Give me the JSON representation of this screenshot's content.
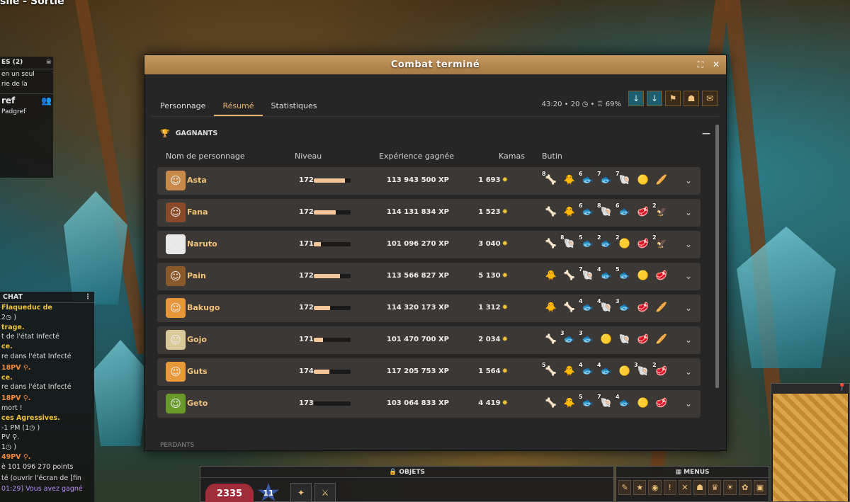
{
  "zone": {
    "title": "sile - Sortie"
  },
  "quests": {
    "header": "ES (2)",
    "lines": [
      "en un seul",
      "rie de la"
    ],
    "section": "ref",
    "section_line": "Padgref"
  },
  "chat": {
    "header": "CHAT",
    "lines": [
      {
        "text": "Flaqueduc de",
        "cls": "yellow-first"
      },
      {
        "text": "2◷ )",
        "cls": ""
      },
      {
        "text": "trage.",
        "cls": "yellow-all"
      },
      {
        "text": "t de l'état Infecté",
        "cls": ""
      },
      {
        "text": "ce.",
        "cls": "yellow-all"
      },
      {
        "text": "re dans l'état Infecté",
        "cls": ""
      },
      {
        "text": "",
        "cls": ""
      },
      {
        "text": "18PV ⚲.",
        "cls": "orange-first"
      },
      {
        "text": "ce.",
        "cls": "yellow-all"
      },
      {
        "text": "re dans l'état Infecté",
        "cls": ""
      },
      {
        "text": "",
        "cls": ""
      },
      {
        "text": "18PV ⚲.",
        "cls": "orange-first"
      },
      {
        "text": "mort !",
        "cls": ""
      },
      {
        "text": "ces Agressives.",
        "cls": "yellow-all"
      },
      {
        "text": "-1 PM (1◷ )",
        "cls": ""
      },
      {
        "text": "PV ⚲.",
        "cls": ""
      },
      {
        "text": "1◷ )",
        "cls": ""
      },
      {
        "text": "49PV ⚲.",
        "cls": "orange-first"
      },
      {
        "text": "è 101 096 270 points",
        "cls": ""
      },
      {
        "text": "",
        "cls": ""
      },
      {
        "text": "té (ouvrir l'écran de [fin",
        "cls": ""
      },
      {
        "text": "",
        "cls": ""
      },
      {
        "text": "01:29] Vous avez gagné",
        "cls": "purple"
      }
    ]
  },
  "window": {
    "title": "Combat terminé",
    "tabs": [
      "Personnage",
      "Résumé",
      "Statistiques"
    ],
    "active_tab": 1,
    "fight_info": "43:20 • 20 ◷ • ♖ 69%",
    "section_title": "GAGNANTS",
    "losers_title": "PERDANTS",
    "columns": {
      "name": "Nom de personnage",
      "level": "Niveau",
      "xp": "Expérience gagnée",
      "kamas": "Kamas",
      "loot": "Butin"
    },
    "winners": [
      {
        "name": "Asta",
        "level": "172",
        "level_fill": 0.85,
        "xp": "113 943 500 XP",
        "kamas": "1 693",
        "avatar_color": "#c9894a",
        "avatar": "☺",
        "loot": [
          {
            "q": "8",
            "i": "🦴"
          },
          {
            "q": "",
            "i": "🐥"
          },
          {
            "q": "6",
            "i": "🐟"
          },
          {
            "q": "7",
            "i": "🐟"
          },
          {
            "q": "7",
            "i": "🐚"
          },
          {
            "q": "",
            "i": "🟡"
          },
          {
            "q": "",
            "i": "🥖"
          }
        ]
      },
      {
        "name": "Fana",
        "level": "172",
        "level_fill": 0.6,
        "xp": "114 131 834 XP",
        "kamas": "1 523",
        "avatar_color": "#8a4a2a",
        "avatar": "☺",
        "loot": [
          {
            "q": "",
            "i": "🦴"
          },
          {
            "q": "",
            "i": "🐥"
          },
          {
            "q": "6",
            "i": "🐟"
          },
          {
            "q": "8",
            "i": "🐚"
          },
          {
            "q": "6",
            "i": "🐟"
          },
          {
            "q": "",
            "i": "🥩"
          },
          {
            "q": "2",
            "i": "🦅"
          }
        ]
      },
      {
        "name": "Naruto",
        "level": "171",
        "level_fill": 0.2,
        "xp": "101 096 270 XP",
        "kamas": "3 040",
        "avatar_color": "#e8e8e8",
        "avatar": "☺",
        "loot": [
          {
            "q": "",
            "i": "🦴"
          },
          {
            "q": "8",
            "i": "🐚"
          },
          {
            "q": "5",
            "i": "🐟"
          },
          {
            "q": "2",
            "i": "🐟"
          },
          {
            "q": "2",
            "i": "🟡"
          },
          {
            "q": "",
            "i": "🥩"
          },
          {
            "q": "2",
            "i": "🦅"
          }
        ]
      },
      {
        "name": "Pain",
        "level": "172",
        "level_fill": 0.72,
        "xp": "113 566 827 XP",
        "kamas": "5 130",
        "avatar_color": "#8a5a2a",
        "avatar": "☺",
        "loot": [
          {
            "q": "",
            "i": "🐥"
          },
          {
            "q": "",
            "i": "🦴"
          },
          {
            "q": "7",
            "i": "🐚"
          },
          {
            "q": "4",
            "i": "🐟"
          },
          {
            "q": "5",
            "i": "🐟"
          },
          {
            "q": "",
            "i": "🟡"
          },
          {
            "q": "",
            "i": "🥩"
          }
        ]
      },
      {
        "name": "Bakugo",
        "level": "172",
        "level_fill": 0.45,
        "xp": "114 320 173 XP",
        "kamas": "1 312",
        "avatar_color": "#e8963a",
        "avatar": "☺",
        "loot": [
          {
            "q": "",
            "i": "🐥"
          },
          {
            "q": "",
            "i": "🦴"
          },
          {
            "q": "4",
            "i": "🐟"
          },
          {
            "q": "4",
            "i": "🐚"
          },
          {
            "q": "3",
            "i": "🐟"
          },
          {
            "q": "",
            "i": "🥩"
          },
          {
            "q": "",
            "i": "🥖"
          }
        ]
      },
      {
        "name": "Gojo",
        "level": "171",
        "level_fill": 0.25,
        "xp": "101 470 700 XP",
        "kamas": "2 034",
        "avatar_color": "#d8c89a",
        "avatar": "☺",
        "loot": [
          {
            "q": "",
            "i": "🦴"
          },
          {
            "q": "3",
            "i": "🐟"
          },
          {
            "q": "3",
            "i": "🐟"
          },
          {
            "q": "",
            "i": "🟡"
          },
          {
            "q": "",
            "i": "🐚"
          },
          {
            "q": "",
            "i": "🥩"
          },
          {
            "q": "",
            "i": "🥖"
          }
        ]
      },
      {
        "name": "Guts",
        "level": "174",
        "level_fill": 0.42,
        "xp": "117 205 753 XP",
        "kamas": "1 564",
        "avatar_color": "#e89a3a",
        "avatar": "☺",
        "loot": [
          {
            "q": "5",
            "i": "🦴"
          },
          {
            "q": "",
            "i": "🐥"
          },
          {
            "q": "4",
            "i": "🐟"
          },
          {
            "q": "4",
            "i": "🐟"
          },
          {
            "q": "",
            "i": "🟡"
          },
          {
            "q": "3",
            "i": "🐚"
          },
          {
            "q": "2",
            "i": "🥩"
          }
        ]
      },
      {
        "name": "Geto",
        "level": "173",
        "level_fill": 0.0,
        "xp": "103 064 833 XP",
        "kamas": "4 419",
        "avatar_color": "#6a9a2a",
        "avatar": "☺",
        "loot": [
          {
            "q": "",
            "i": "🦴"
          },
          {
            "q": "",
            "i": "🐥"
          },
          {
            "q": "5",
            "i": "🐟"
          },
          {
            "q": "7",
            "i": "🐚"
          },
          {
            "q": "4",
            "i": "🐟"
          },
          {
            "q": "",
            "i": "🟡"
          },
          {
            "q": "",
            "i": "🥩"
          }
        ]
      }
    ],
    "result_icons": [
      "↓",
      "↓",
      "⚑",
      "☗",
      "✉"
    ]
  },
  "hud": {
    "objets": "OBJETS",
    "menus": "MENUS",
    "hp": "2335",
    "ap": "11",
    "slots": [
      {
        "q": "1",
        "i": "✦"
      },
      {
        "q": "",
        "i": "⚔"
      }
    ],
    "menu_icons": [
      "✎",
      "★",
      "◉",
      "!",
      "✕",
      "☗",
      "♛",
      "☀",
      "✿",
      "▣"
    ]
  }
}
